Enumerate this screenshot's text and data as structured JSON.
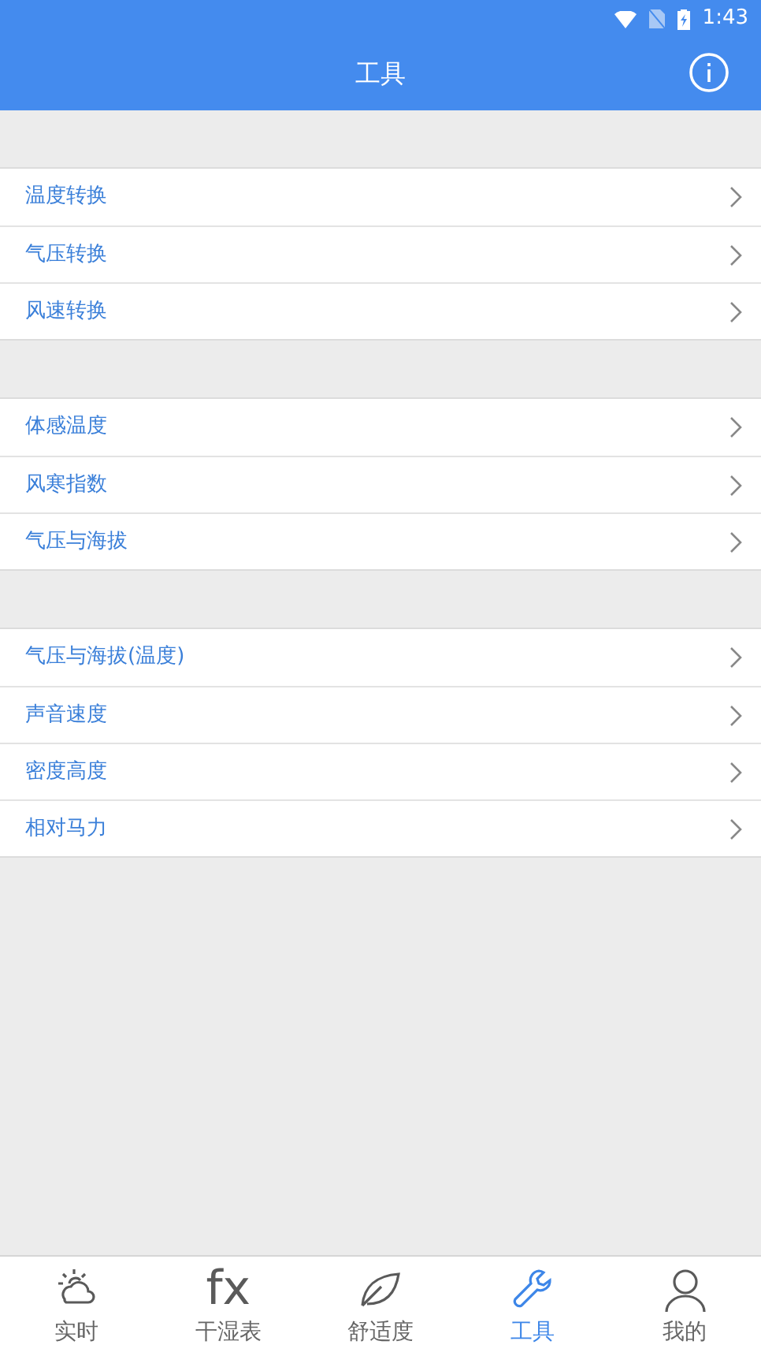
{
  "status_bar": {
    "time": "1:43"
  },
  "header": {
    "title": "工具"
  },
  "groups": [
    {
      "items": [
        "温度转换",
        "气压转换",
        "风速转换"
      ]
    },
    {
      "items": [
        "体感温度",
        "风寒指数",
        "气压与海拔"
      ]
    },
    {
      "items": [
        "气压与海拔(温度)",
        "声音速度",
        "密度高度",
        "相对马力"
      ]
    }
  ],
  "tabs": [
    {
      "kind": "weather",
      "label": "实时",
      "selected": false
    },
    {
      "kind": "formula",
      "glyph": "fx",
      "label": "干湿表",
      "selected": false
    },
    {
      "kind": "leaf",
      "label": "舒适度",
      "selected": false
    },
    {
      "kind": "wrench",
      "label": "工具",
      "selected": true
    },
    {
      "kind": "person",
      "label": "我的",
      "selected": false
    }
  ]
}
